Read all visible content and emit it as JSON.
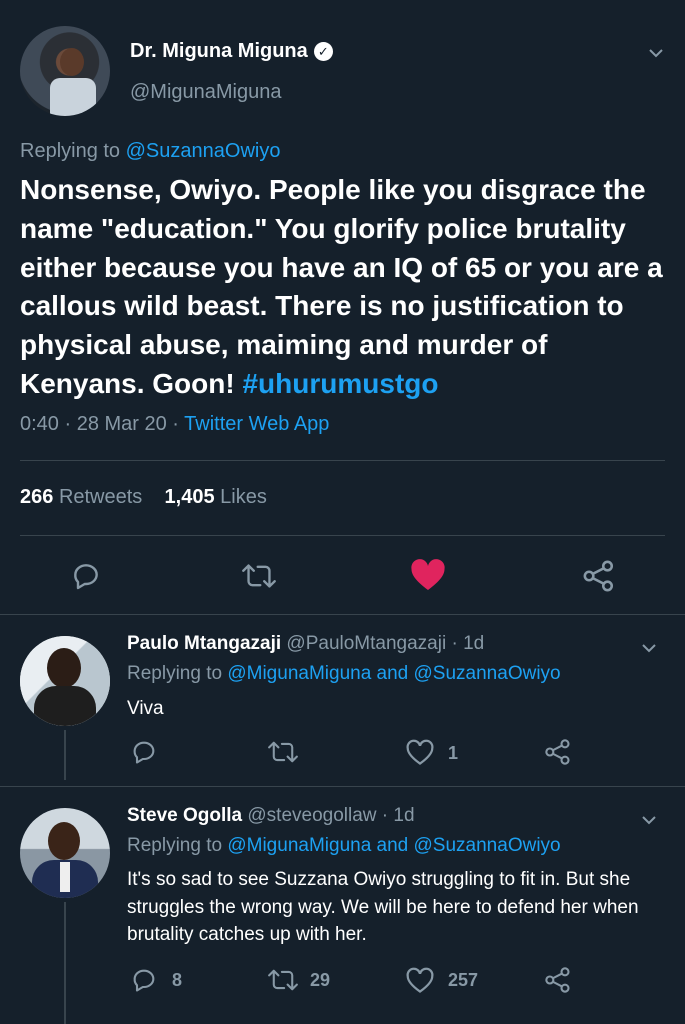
{
  "tweet": {
    "author_name": "Dr. Miguna Miguna",
    "author_handle": "@MigunaMiguna",
    "replying_label": "Replying to",
    "replying_to": "@SuzannaOwiyo",
    "text": "Nonsense, Owiyo. People like you disgrace the name \"education.\" You glorify police brutality either because you have an IQ of 65 or you are a callous wild beast. There is no justification to physical abuse, maiming and murder of Kenyans. Goon!",
    "hashtag": "#uhurumustgo",
    "time": "0:40 · 28 Mar 20 ·",
    "source": "Twitter Web App",
    "retweets_count": "266",
    "retweets_label": "Retweets",
    "likes_count": "1,405",
    "likes_label": "Likes"
  },
  "replies": [
    {
      "name": "Paulo Mtangazaji",
      "handle_time": "@PauloMtangazaji · 1d",
      "replying_label": "Replying to",
      "replying_to": "@MigunaMiguna and @SuzannaOwiyo",
      "text": "Viva",
      "reply_count": "",
      "retweet_count": "",
      "like_count": "1"
    },
    {
      "name": "Steve Ogolla",
      "handle_time": "@steveogollaw · 1d",
      "replying_label": "Replying to",
      "replying_to": "@MigunaMiguna and @SuzannaOwiyo",
      "text": "It's so sad to see Suzzana Owiyo struggling to fit in. But she struggles the wrong way. We will be here to defend her when brutality catches up with her.",
      "reply_count": "8",
      "retweet_count": "29",
      "like_count": "257"
    }
  ],
  "colors": {
    "background": "#15202b",
    "muted": "#8899a6",
    "link": "#1da1f2",
    "like_active": "#e0245e",
    "divider": "#38444d"
  },
  "icons": [
    "reply-icon",
    "retweet-icon",
    "like-icon",
    "share-icon",
    "chevron-down-icon",
    "verified-icon"
  ]
}
